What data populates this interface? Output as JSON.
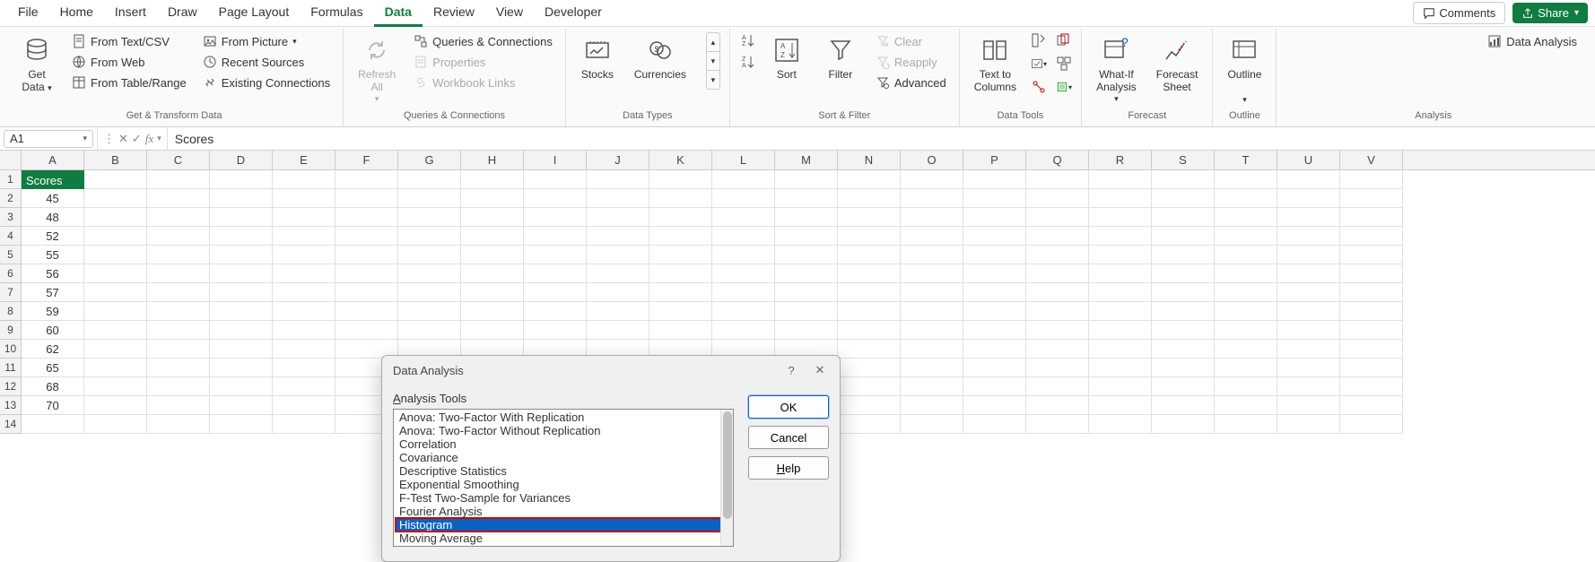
{
  "tabs": {
    "items": [
      "File",
      "Home",
      "Insert",
      "Draw",
      "Page Layout",
      "Formulas",
      "Data",
      "Review",
      "View",
      "Developer"
    ],
    "active": 6,
    "comments": "Comments",
    "share": "Share"
  },
  "ribbon": {
    "get_transform": {
      "label": "Get & Transform Data",
      "get_data": "Get\nData",
      "from_text_csv": "From Text/CSV",
      "from_web": "From Web",
      "from_table": "From Table/Range",
      "from_picture": "From Picture",
      "recent_sources": "Recent Sources",
      "existing_connections": "Existing Connections"
    },
    "queries": {
      "label": "Queries & Connections",
      "refresh_all": "Refresh\nAll",
      "queries_connections": "Queries & Connections",
      "properties": "Properties",
      "workbook_links": "Workbook Links"
    },
    "data_types": {
      "label": "Data Types",
      "stocks": "Stocks",
      "currencies": "Currencies"
    },
    "sort_filter": {
      "label": "Sort & Filter",
      "sort": "Sort",
      "filter": "Filter",
      "clear": "Clear",
      "reapply": "Reapply",
      "advanced": "Advanced"
    },
    "data_tools": {
      "label": "Data Tools",
      "text_to_columns": "Text to\nColumns"
    },
    "forecast": {
      "label": "Forecast",
      "what_if": "What-If\nAnalysis",
      "forecast_sheet": "Forecast\nSheet"
    },
    "outline": {
      "label": "Outline",
      "outline": "Outline"
    },
    "analysis": {
      "label": "Analysis",
      "data_analysis": "Data Analysis"
    }
  },
  "name_box": "A1",
  "formula": "Scores",
  "columns": [
    "A",
    "B",
    "C",
    "D",
    "E",
    "F",
    "G",
    "H",
    "I",
    "J",
    "K",
    "L",
    "M",
    "N",
    "O",
    "P",
    "Q",
    "R",
    "S",
    "T",
    "U",
    "V"
  ],
  "rows": [
    {
      "n": 1,
      "a": "Scores",
      "header": true
    },
    {
      "n": 2,
      "a": "45"
    },
    {
      "n": 3,
      "a": "48"
    },
    {
      "n": 4,
      "a": "52"
    },
    {
      "n": 5,
      "a": "55"
    },
    {
      "n": 6,
      "a": "56"
    },
    {
      "n": 7,
      "a": "57"
    },
    {
      "n": 8,
      "a": "59"
    },
    {
      "n": 9,
      "a": "60"
    },
    {
      "n": 10,
      "a": "62"
    },
    {
      "n": 11,
      "a": "65"
    },
    {
      "n": 12,
      "a": "68"
    },
    {
      "n": 13,
      "a": "70"
    },
    {
      "n": 14,
      "a": ""
    }
  ],
  "dialog": {
    "title": "Data Analysis",
    "tools_label_pre": "A",
    "tools_label_post": "nalysis Tools",
    "items": [
      "Anova: Two-Factor With Replication",
      "Anova: Two-Factor Without Replication",
      "Correlation",
      "Covariance",
      "Descriptive Statistics",
      "Exponential Smoothing",
      "F-Test Two-Sample for Variances",
      "Fourier Analysis",
      "Histogram",
      "Moving Average"
    ],
    "selected_index": 8,
    "ok": "OK",
    "cancel": "Cancel",
    "help_pre": "H",
    "help_post": "elp"
  }
}
